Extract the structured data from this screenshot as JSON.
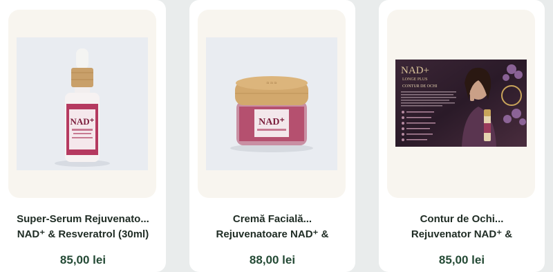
{
  "products": [
    {
      "title_line1": "Super-Serum Rejuvenato...",
      "title_line2": "NAD⁺ & Resveratrol (30ml)",
      "price": "85,00 lei",
      "label_brand": "NAD⁺"
    },
    {
      "title_line1": "Cremă Facială...",
      "title_line2": "Rejuvenatoare NAD⁺ &",
      "price": "88,00 lei",
      "label_brand": "NAD⁺"
    },
    {
      "title_line1": "Contur de Ochi...",
      "title_line2": "Rejuvenator NAD⁺ &",
      "price": "85,00 lei",
      "banner_title": "NAD+",
      "banner_subtitle": "LONGE PLUS",
      "banner_caption": "CONTUR DE OCHI"
    }
  ],
  "colors": {
    "page_bg": "#e9ecec",
    "card_bg": "#ffffff",
    "media_bg": "#f8f5ef",
    "title": "#1f2c24",
    "price": "#244a35"
  }
}
